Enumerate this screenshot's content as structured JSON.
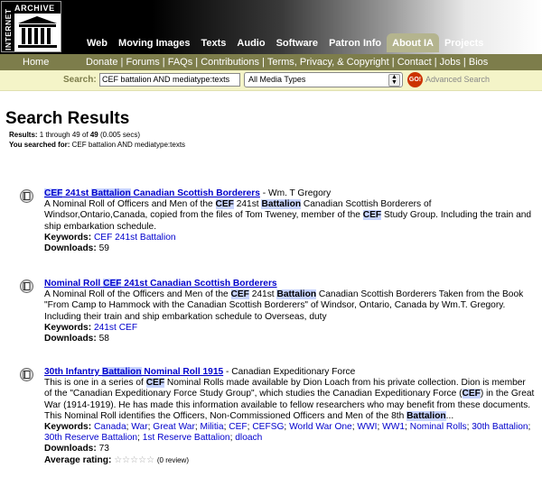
{
  "logo": {
    "vertical_text": "INTERNET",
    "horizontal_text": "ARCHIVE"
  },
  "nav": {
    "tabs": [
      "Web",
      "Moving Images",
      "Texts",
      "Audio",
      "Software",
      "Patron Info",
      "About IA",
      "Projects"
    ],
    "active": "About IA"
  },
  "subnav": {
    "home": "Home",
    "links": [
      "Donate",
      "Forums",
      "FAQs",
      "Contributions",
      "Terms, Privacy, & Copyright",
      "Contact",
      "Jobs",
      "Bios"
    ]
  },
  "search": {
    "label": "Search:",
    "value": "CEF battalion AND mediatype:texts",
    "media_select": "All Media Types",
    "go_label": "GO!",
    "advanced": "Advanced Search"
  },
  "results_header": {
    "title": "Search Results",
    "results_label": "Results:",
    "results_text": "1 through 49 of",
    "total": "49",
    "timing": "(0.005 secs)",
    "you_searched_label": "You searched for:",
    "query": "CEF battalion AND mediatype:texts"
  },
  "results": [
    {
      "title_parts": [
        "CEF",
        " 241st ",
        "Battalion",
        " Canadian Scottish Borderers"
      ],
      "author": " - Wm. T Gregory",
      "desc_parts": [
        "A Nominal Roll of Officers and Men of the ",
        "CEF",
        " 241st ",
        "Battalion",
        " Canadian Scottish Borderers of Windsor,Ontario,Canada, copied from the files of Tom Tweney, member of the ",
        "CEF",
        " Study Group. Including the train and ship embarkation schedule."
      ],
      "keywords_label": "Keywords:",
      "keywords": [
        "CEF 241st Battalion"
      ],
      "downloads_label": "Downloads:",
      "downloads": "59"
    },
    {
      "title_parts": [
        "Nominal Roll ",
        "CEF",
        " 241st Canadian Scottish Borderers"
      ],
      "author": "",
      "desc_parts": [
        "A Nominal Roll of the Officers and Men of the ",
        "CEF",
        " 241st ",
        "Battalion",
        " Canadian Scottish Borderers Taken from the Book \"From Camp to Hammock with the Canadian Scottish Borderers\" of Windsor, Ontario, Canada by Wm.T. Gregory. Including their train and ship embarkation schedule to Overseas, duty"
      ],
      "keywords_label": "Keywords:",
      "keywords": [
        "241st CEF"
      ],
      "downloads_label": "Downloads:",
      "downloads": "58"
    },
    {
      "title_parts": [
        "30th Infantry ",
        "Battalion",
        " Nominal Roll 1915"
      ],
      "author": " - Canadian Expeditionary Force",
      "desc_parts": [
        "This is one in a series of ",
        "CEF",
        " Nominal Rolls made available by Dion Loach from his private collection. Dion is member of the \"Canadian Expeditionary Force Study Group\", which studies the Canadian Expeditionary Force (",
        "CEF",
        ") in the Great War (1914-1919). He has made this information available to fellow researchers who may benefit from these documents. This Nominal Roll identifies the Officers, Non-Commissioned Officers and Men of the 8th ",
        "Battalion",
        "..."
      ],
      "keywords_label": "Keywords:",
      "keywords": [
        "Canada",
        "War",
        "Great War",
        "Militia",
        "CEF",
        "CEFSG",
        "World War One",
        "WWI",
        "WW1",
        "Nominal Rolls",
        "30th Battalion",
        "30th Reserve Battalion",
        "1st Reserve Battalion",
        "dloach"
      ],
      "downloads_label": "Downloads:",
      "downloads": "73",
      "rating_label": "Average rating:",
      "stars": "☆☆☆☆☆",
      "reviews": "(0 review)"
    }
  ]
}
